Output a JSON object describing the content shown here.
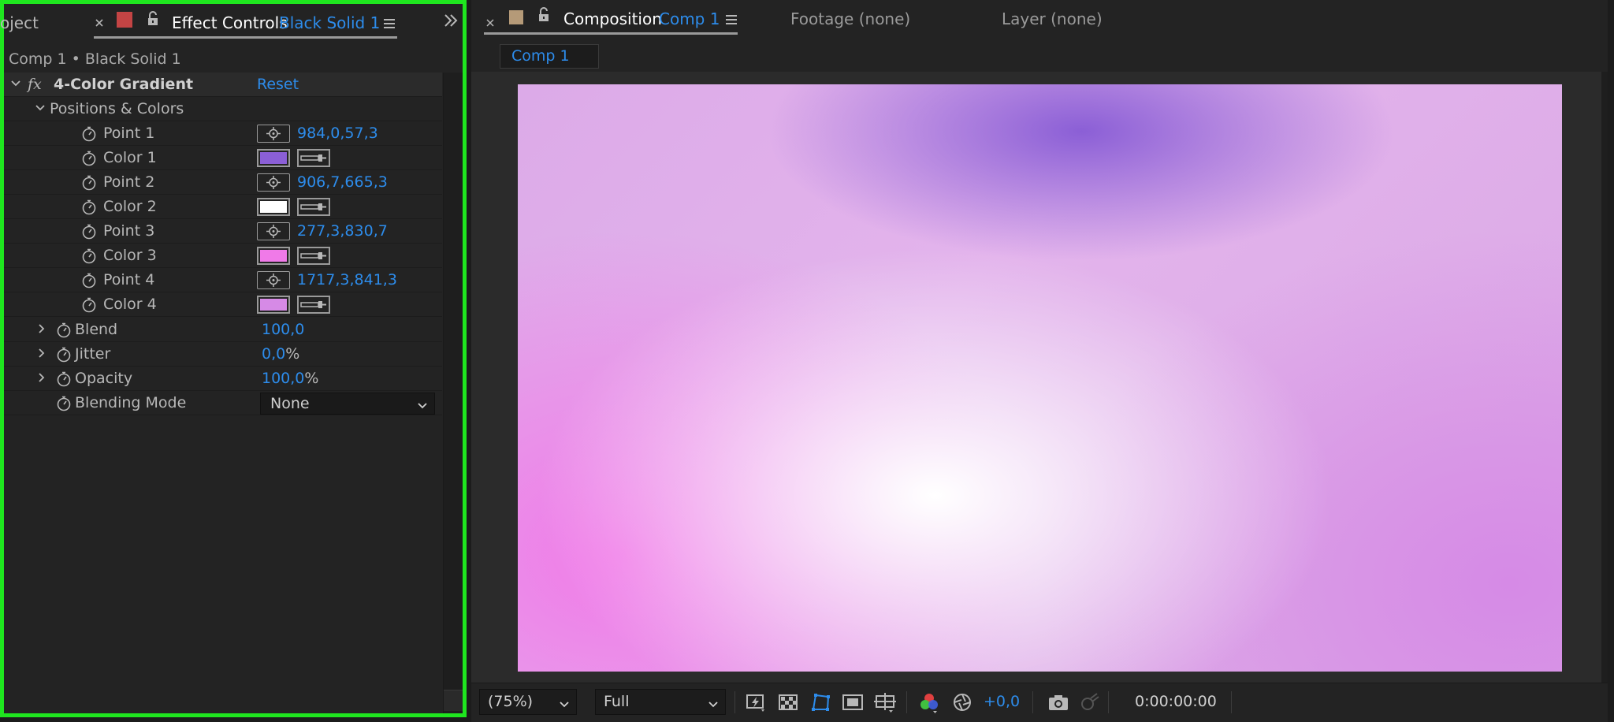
{
  "left_panel": {
    "tab_project_partial": "oject",
    "tab_effect_controls_title": "Effect Controls",
    "tab_effect_controls_layer": "Black Solid 1",
    "breadcrumb": "Comp 1 • Black Solid 1",
    "effect": {
      "fx_symbol": "fx",
      "name": "4-Color Gradient",
      "reset_label": "Reset"
    },
    "group_label": "Positions & Colors",
    "properties": [
      {
        "label": "Point 1",
        "kind": "point",
        "value": "984,0,57,3"
      },
      {
        "label": "Color 1",
        "kind": "color",
        "color": "#8b5fd6"
      },
      {
        "label": "Point 2",
        "kind": "point",
        "value": "906,7,665,3"
      },
      {
        "label": "Color 2",
        "kind": "color",
        "color": "#ffffff"
      },
      {
        "label": "Point 3",
        "kind": "point",
        "value": "277,3,830,7"
      },
      {
        "label": "Color 3",
        "kind": "color",
        "color": "#f07ae8"
      },
      {
        "label": "Point 4",
        "kind": "point",
        "value": "1717,3,841,3"
      },
      {
        "label": "Color 4",
        "kind": "color",
        "color": "#d68ae6"
      }
    ],
    "blend": {
      "label": "Blend",
      "value": "100,0"
    },
    "jitter": {
      "label": "Jitter",
      "value": "0,0",
      "unit": "%"
    },
    "opacity": {
      "label": "Opacity",
      "value": "100,0",
      "unit": "%"
    },
    "blending_mode": {
      "label": "Blending Mode",
      "value": "None"
    }
  },
  "right_panel": {
    "tab_composition_title": "Composition",
    "tab_composition_name": "Comp 1",
    "tab_footage": "Footage (none)",
    "tab_layer": "Layer (none)",
    "subtab": "Comp 1",
    "bottom_bar": {
      "zoom": "(75%)",
      "resolution": "Full",
      "exposure": "+0,0",
      "timecode": "0:00:00:00"
    }
  },
  "colors": {
    "accent_blue": "#2d8ceb",
    "focus_border": "#1fe61f",
    "effect_label_color": "#c44444",
    "comp_label_color": "#b59a78"
  },
  "icons": {
    "close": "close-icon",
    "lock": "lock-icon",
    "menu": "hamburger-menu-icon",
    "overflow": "double-chevron-right-icon",
    "stopwatch": "stopwatch-icon",
    "point_control": "crosshair-icon",
    "eyedropper": "eyedropper-icon"
  }
}
